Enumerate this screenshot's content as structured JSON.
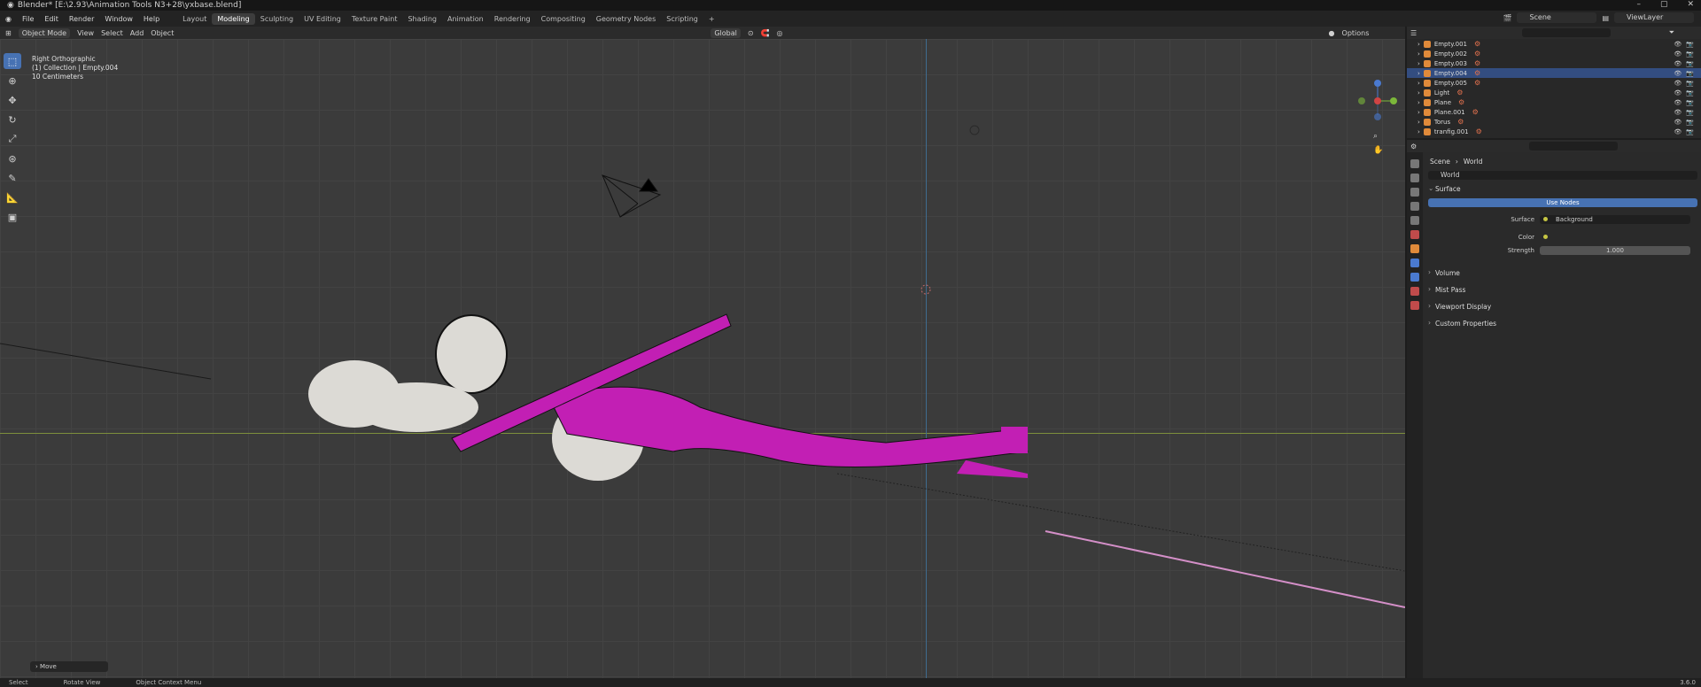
{
  "title_bar": {
    "title": "Blender* [E:\\2.93\\Animation Tools N3+28\\yxbase.blend]",
    "minimize": "–",
    "maximize": "▢",
    "close": "✕"
  },
  "menu": {
    "items": [
      "File",
      "Edit",
      "Render",
      "Window",
      "Help"
    ],
    "workspaces": [
      "Layout",
      "Modeling",
      "Sculpting",
      "UV Editing",
      "Texture Paint",
      "Shading",
      "Animation",
      "Rendering",
      "Compositing",
      "Geometry Nodes",
      "Scripting",
      "+"
    ],
    "active_workspace": "Modeling",
    "scene": "Scene",
    "view_layer": "ViewLayer"
  },
  "viewport": {
    "mode": "Object Mode",
    "menu": [
      "View",
      "Select",
      "Add",
      "Object"
    ],
    "transform_orientation": "Global",
    "options": "Options",
    "info_lines": [
      "Right Orthographic",
      "(1) Collection | Empty.004",
      "10 Centimeters"
    ],
    "last_operator": "Move"
  },
  "outliner": {
    "rows": [
      {
        "name": "Empty.001",
        "selected": false
      },
      {
        "name": "Empty.002",
        "selected": false
      },
      {
        "name": "Empty.003",
        "selected": false
      },
      {
        "name": "Empty.004",
        "selected": true
      },
      {
        "name": "Empty.005",
        "selected": false
      },
      {
        "name": "Light",
        "selected": false
      },
      {
        "name": "Plane",
        "selected": false
      },
      {
        "name": "Plane.001",
        "selected": false
      },
      {
        "name": "Torus",
        "selected": false
      },
      {
        "name": "tranfig.001",
        "selected": false
      }
    ]
  },
  "properties": {
    "breadcrumb": [
      "Scene",
      "World"
    ],
    "world_name": "World",
    "surface_panel": "Surface",
    "use_nodes": "Use Nodes",
    "surface_label": "Surface",
    "surface_value": "Background",
    "color_label": "Color",
    "strength_label": "Strength",
    "strength_value": "1.000",
    "collapsed_panels": [
      "Volume",
      "Mist Pass",
      "Viewport Display",
      "Custom Properties"
    ]
  },
  "status": {
    "select": "Select",
    "rotate": "Rotate View",
    "context": "Object Context Menu",
    "version": "3.6.0"
  },
  "colors": {
    "accent": "#4772b3",
    "figure_magenta": "#c21fb4",
    "figure_skin": "#dcdad5"
  }
}
